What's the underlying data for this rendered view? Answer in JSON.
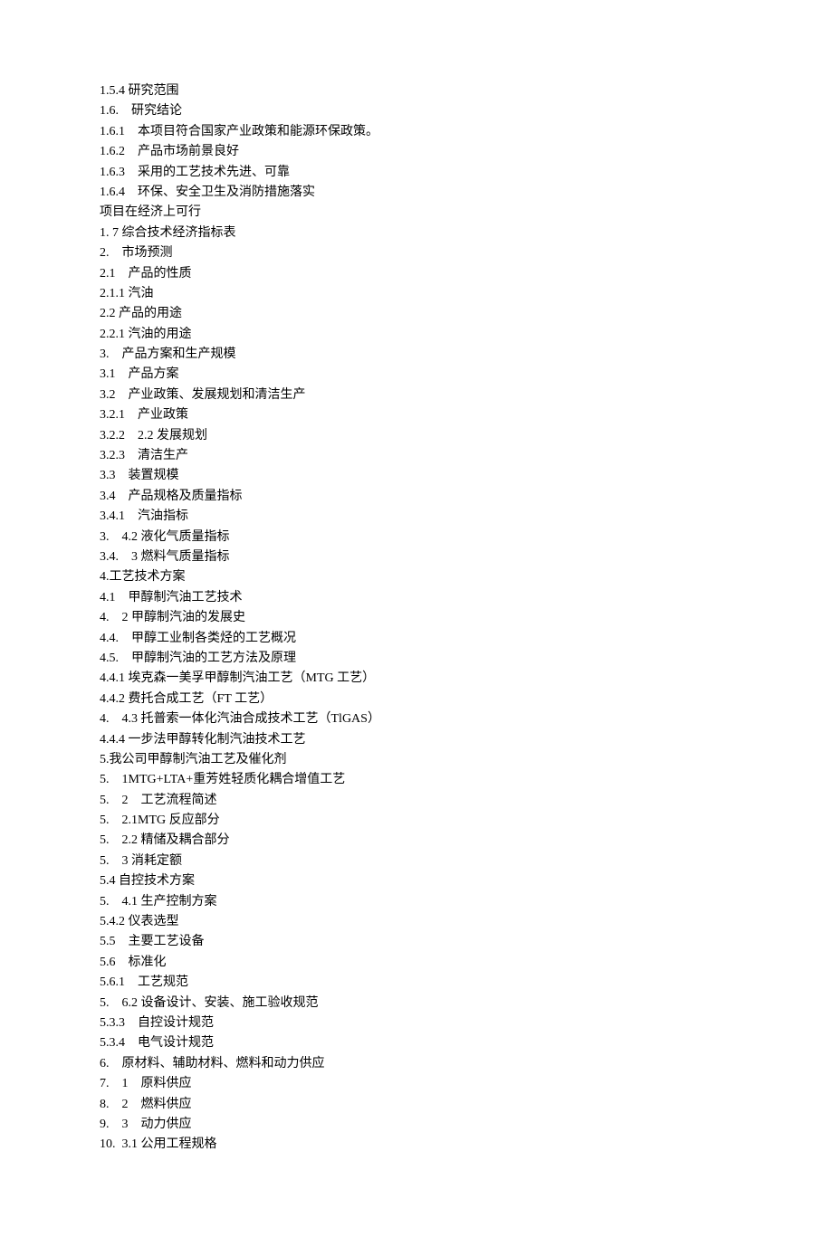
{
  "lines": [
    "1.5.4 研究范围",
    "1.6.    研究结论",
    "1.6.1    本项目符合国家产业政策和能源环保政策。",
    "1.6.2    产品市场前景良好",
    "1.6.3    采用的工艺技术先进、可靠",
    "1.6.4    环保、安全卫生及消防措施落实",
    "项目在经济上可行",
    "1. 7 综合技术经济指标表",
    "2.    市场预测",
    "2.1    产品的性质",
    "2.1.1 汽油",
    "2.2 产品的用途",
    "2.2.1 汽油的用途",
    "3.    产品方案和生产规模",
    "3.1    产品方案",
    "3.2    产业政策、发展规划和清洁生产",
    "3.2.1    产业政策",
    "3.2.2    2.2 发展规划",
    "3.2.3    清洁生产",
    "3.3    装置规模",
    "3.4    产品规格及质量指标",
    "3.4.1    汽油指标",
    "3.    4.2 液化气质量指标",
    "3.4.    3 燃料气质量指标",
    "4.工艺技术方案",
    "4.1    甲醇制汽油工艺技术",
    "4.    2 甲醇制汽油的发展史",
    "4.4.    甲醇工业制各类烃的工艺概况",
    "4.5.    甲醇制汽油的工艺方法及原理",
    "4.4.1 埃克森一美孚甲醇制汽油工艺（MTG 工艺）",
    "4.4.2 费托合成工艺（FT 工艺）",
    "4.    4.3 托普索一体化汽油合成技术工艺（TlGAS）",
    "4.4.4 一步法甲醇转化制汽油技术工艺",
    "5.我公司甲醇制汽油工艺及催化剂",
    "5.    1MTG+LTA+重芳姓轻质化耦合增值工艺",
    "5.    2    工艺流程简述",
    "5.    2.1MTG 反应部分",
    "5.    2.2 精储及耦合部分",
    "5.    3 消耗定额",
    "5.4 自控技术方案",
    "5.    4.1 生产控制方案",
    "5.4.2 仪表选型",
    "5.5    主要工艺设备",
    "5.6    标准化",
    "5.6.1    工艺规范",
    "5.    6.2 设备设计、安装、施工验收规范",
    "5.3.3    自控设计规范",
    "5.3.4    电气设计规范",
    "6.    原材料、辅助材料、燃料和动力供应",
    "7.    1    原料供应",
    "8.    2    燃料供应",
    "9.    3    动力供应",
    "10.  3.1 公用工程规格"
  ]
}
